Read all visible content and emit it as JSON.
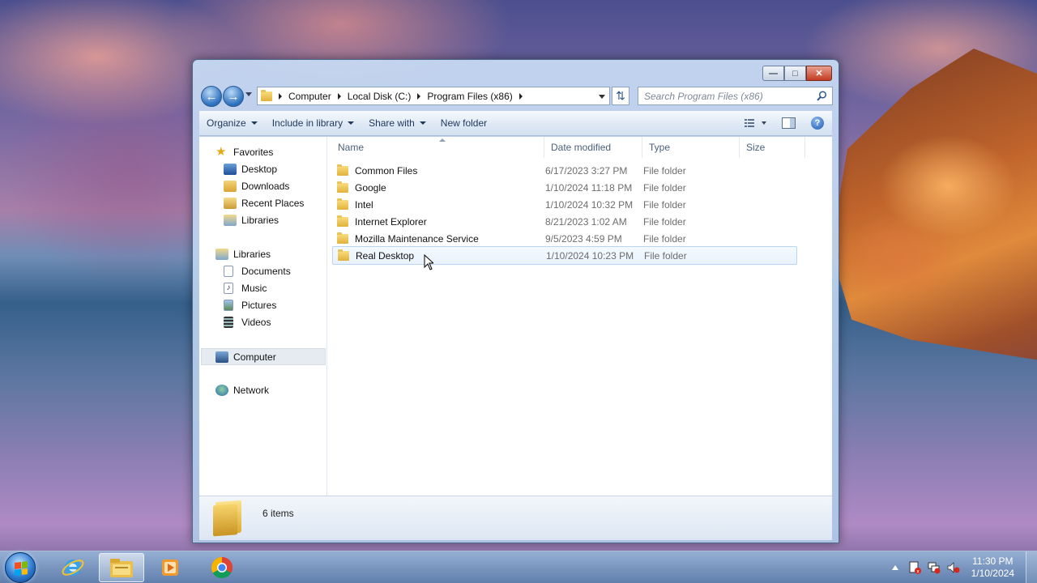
{
  "window": {
    "address_crumbs": [
      "Computer",
      "Local Disk (C:)",
      "Program Files (x86)"
    ],
    "search_placeholder": "Search Program Files (x86)",
    "caption_buttons": {
      "minimize": "minimize-icon",
      "maximize": "maximize-icon",
      "close": "close-icon"
    }
  },
  "toolbar": {
    "organize": "Organize",
    "include_in_library": "Include in library",
    "share_with": "Share with",
    "new_folder": "New folder"
  },
  "navigation": {
    "favorites_header": "Favorites",
    "favorites": [
      "Desktop",
      "Downloads",
      "Recent Places",
      "Libraries"
    ],
    "libraries_header": "Libraries",
    "libraries": [
      "Documents",
      "Music",
      "Pictures",
      "Videos"
    ],
    "computer": "Computer",
    "network": "Network"
  },
  "file_list": {
    "columns": {
      "name": "Name",
      "date_modified": "Date modified",
      "type": "Type",
      "size": "Size"
    },
    "rows": [
      {
        "name": "Common Files",
        "date": "6/17/2023 3:27 PM",
        "type": "File folder"
      },
      {
        "name": "Google",
        "date": "1/10/2024 11:18 PM",
        "type": "File folder"
      },
      {
        "name": "Intel",
        "date": "1/10/2024 10:32 PM",
        "type": "File folder"
      },
      {
        "name": "Internet Explorer",
        "date": "8/21/2023 1:02 AM",
        "type": "File folder"
      },
      {
        "name": "Mozilla Maintenance Service",
        "date": "9/5/2023 4:59 PM",
        "type": "File folder"
      },
      {
        "name": "Real Desktop",
        "date": "1/10/2024 10:23 PM",
        "type": "File folder"
      }
    ],
    "hovered_row": "Real Desktop"
  },
  "details": {
    "item_count": "6 items"
  },
  "taskbar": {
    "apps": [
      "internet-explorer-icon",
      "windows-explorer-icon",
      "media-player-icon",
      "chrome-icon"
    ],
    "active_app": "windows-explorer-icon",
    "clock_time": "11:30 PM",
    "clock_date": "1/10/2024"
  },
  "colors": {
    "accent": "#2a6fbd",
    "hover_row": "#e8f2fd",
    "close_button": "#c33b22"
  }
}
